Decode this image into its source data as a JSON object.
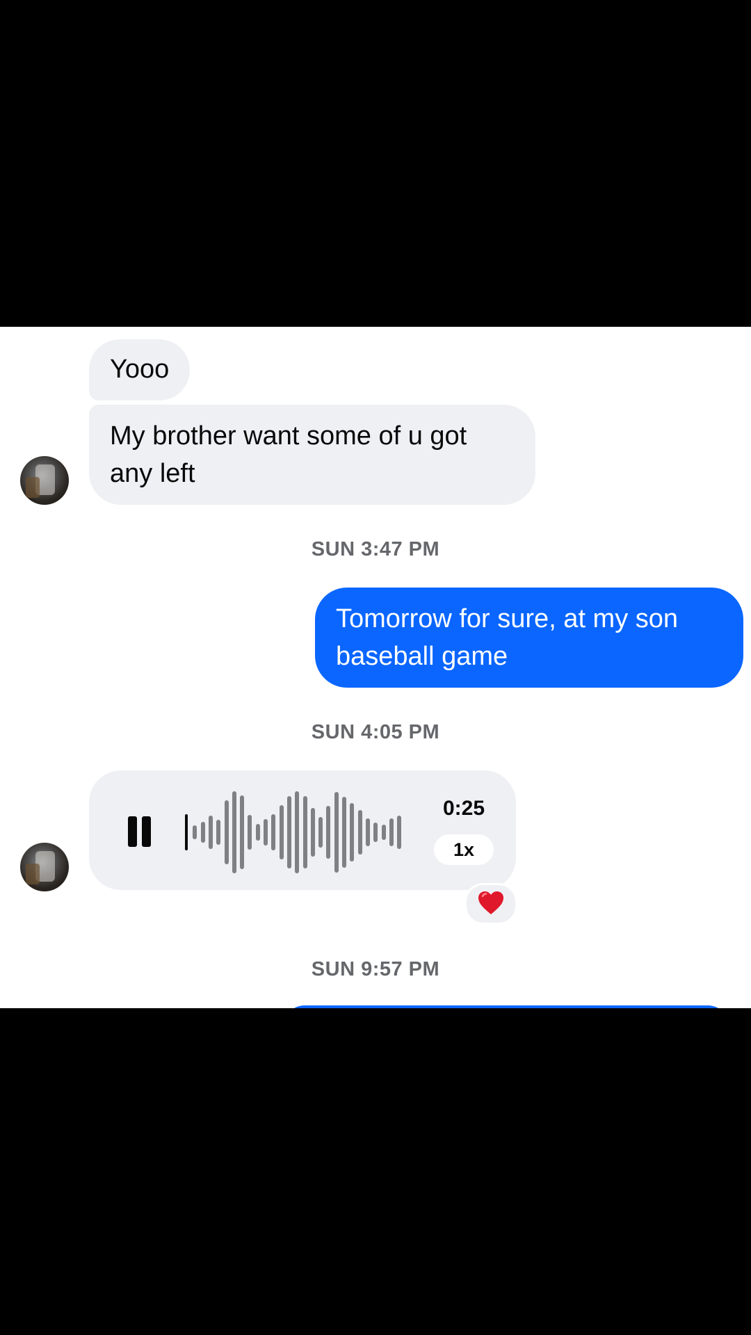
{
  "messages": {
    "incoming_1": "Yooo",
    "incoming_2_line1": "My brother want some of u got",
    "incoming_2_line2": "any left",
    "outgoing_1_line1": "Tomorrow for sure, at my son",
    "outgoing_1_line2": "baseball game"
  },
  "timestamps": {
    "t1": "SUN 3:47 PM",
    "t2": "SUN 4:05 PM",
    "t3": "SUN 9:57 PM"
  },
  "voice_message": {
    "duration": "0:25",
    "speed": "1x",
    "state": "playing"
  },
  "reaction": {
    "emoji": "heart"
  },
  "colors": {
    "outgoing_bubble": "#0a66ff",
    "incoming_bubble": "#eff0f4",
    "timestamp_text": "#65676b",
    "waveform": "#7f8084",
    "reaction_heart": "#e0182b"
  }
}
